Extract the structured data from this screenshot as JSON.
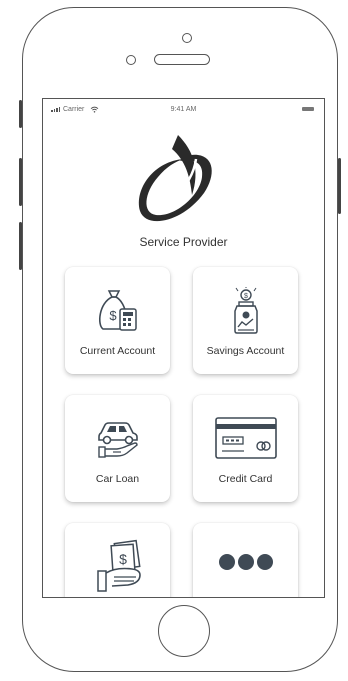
{
  "status_bar": {
    "carrier": "Carrier",
    "time": "9:41 AM"
  },
  "app": {
    "title": "Service Provider"
  },
  "tiles": [
    {
      "label": "Current Account",
      "icon": "money-bag-calculator-icon"
    },
    {
      "label": "Savings Account",
      "icon": "savings-jar-icon"
    },
    {
      "label": "Car Loan",
      "icon": "car-loan-icon"
    },
    {
      "label": "Credit Card",
      "icon": "credit-card-icon"
    },
    {
      "label": "",
      "icon": "hand-cash-icon"
    },
    {
      "label": "",
      "icon": "more-dots-icon"
    }
  ],
  "colors": {
    "icon": "#3f4a55",
    "text": "#333333",
    "frame": "#555555"
  }
}
